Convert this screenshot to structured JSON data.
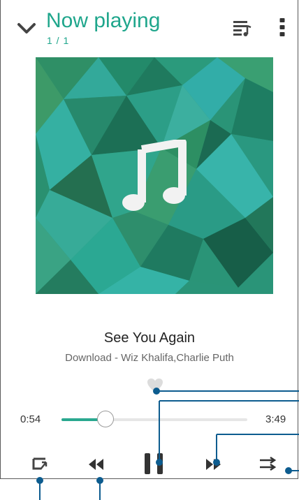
{
  "header": {
    "title": "Now playing",
    "position": "1 / 1",
    "back_icon": "chevron-down-icon",
    "queue_icon": "playlist-music-icon",
    "more_icon": "more-vert-icon"
  },
  "album_art": {
    "icon": "music-note-icon",
    "colors": [
      "#1e8a6e",
      "#2aa88f",
      "#35b2a6",
      "#217a5c",
      "#3f9a6a"
    ]
  },
  "track": {
    "title": "See You Again",
    "subtitle": "Download - Wiz Khalifa,Charlie Puth"
  },
  "favorite": {
    "icon": "heart-icon",
    "selected": false
  },
  "progress": {
    "current": "0:54",
    "total": "3:49",
    "fraction": 0.236
  },
  "controls": {
    "repeat_icon": "repeat-icon",
    "previous_icon": "rewind-icon",
    "pause_icon": "pause-icon",
    "next_icon": "fast-forward-icon",
    "shuffle_icon": "shuffle-icon"
  },
  "colors": {
    "accent": "#1fa68c",
    "annotation": "#0d5c8f"
  }
}
